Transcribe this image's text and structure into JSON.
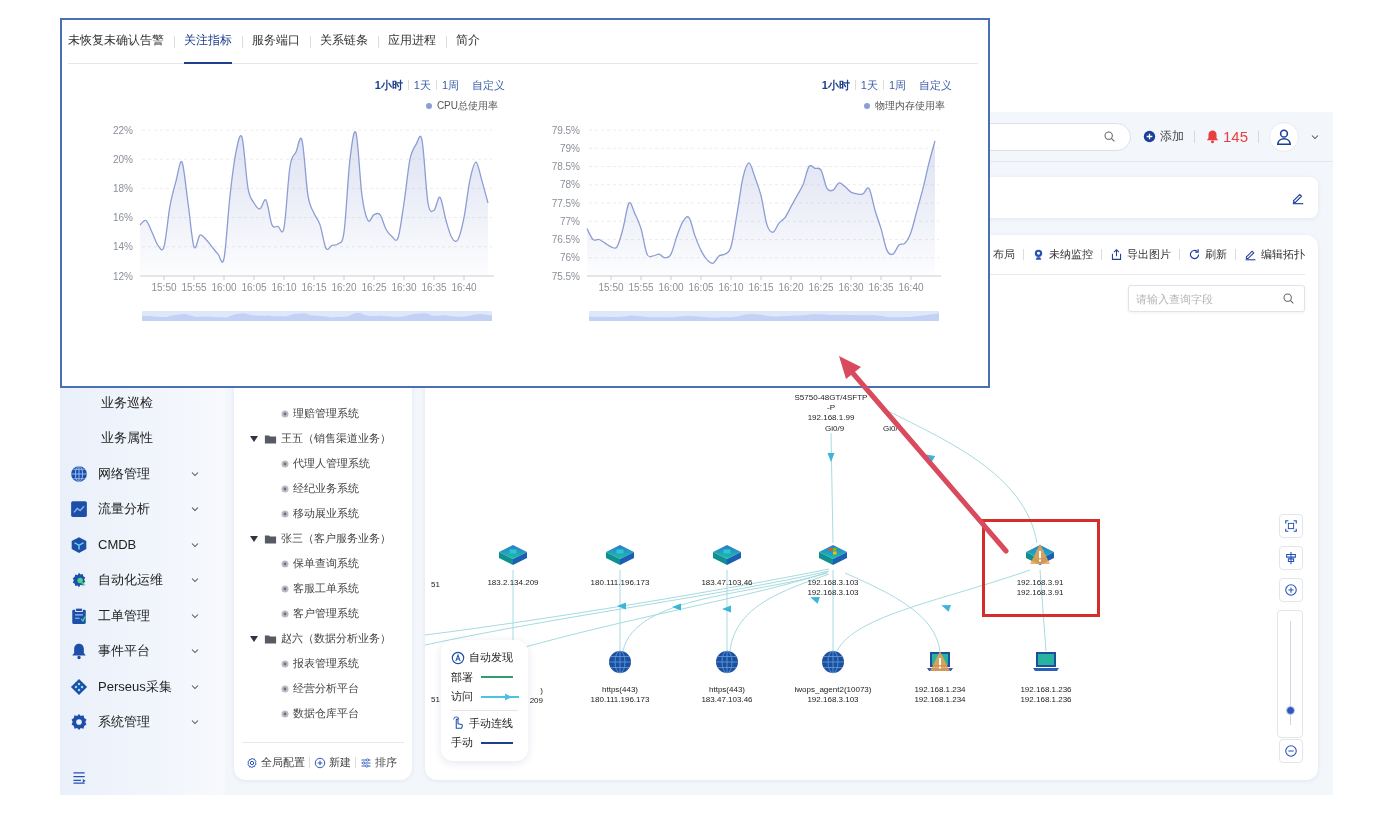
{
  "popup": {
    "tabs": [
      {
        "label": "未恢复未确认告警",
        "selected": false
      },
      {
        "label": "关注指标",
        "selected": true
      },
      {
        "label": "服务端口",
        "selected": false
      },
      {
        "label": "关系链条",
        "selected": false
      },
      {
        "label": "应用进程",
        "selected": false
      },
      {
        "label": "简介",
        "selected": false
      }
    ],
    "panels": [
      {
        "ranges": [
          {
            "label": "1小时",
            "selected": true
          },
          {
            "label": "1天",
            "selected": false
          },
          {
            "label": "1周",
            "selected": false
          }
        ],
        "custom": "自定义",
        "chart_data": {
          "type": "area",
          "grid": true,
          "categories": [
            null,
            null,
            null,
            null,
            "15:50",
            null,
            null,
            null,
            null,
            "15:55",
            null,
            null,
            null,
            null,
            "16:00",
            null,
            null,
            null,
            null,
            "16:05",
            null,
            null,
            null,
            null,
            "16:10",
            null,
            null,
            null,
            null,
            "16:15",
            null,
            null,
            null,
            null,
            "16:20",
            null,
            null,
            null,
            null,
            "16:25",
            null,
            null,
            null,
            null,
            "16:30",
            null,
            null,
            null,
            null,
            "16:35",
            null,
            null,
            null,
            null,
            "16:40",
            null,
            null,
            null,
            null
          ],
          "series": [
            {
              "name": "CPU总使用率",
              "color": "#8d9dd4",
              "values": [
                15.5,
                15.8,
                15.0,
                14.1,
                14.0,
                16.8,
                18.5,
                19.8,
                17.0,
                14.0,
                14.8,
                14.5,
                14.0,
                13.5,
                13.2,
                17.5,
                20.5,
                21.5,
                18.0,
                17.0,
                16.6,
                17.2,
                15.5,
                15.4,
                15.3,
                19.5,
                20.5,
                21.3,
                17.5,
                16.3,
                15.5,
                13.9,
                14.1,
                14.2,
                15.0,
                20.0,
                21.8,
                17.5,
                15.8,
                16.2,
                16.2,
                15.2,
                14.7,
                14.6,
                17.0,
                20.0,
                21.0,
                21.3,
                17.0,
                16.5,
                17.4,
                15.8,
                14.6,
                14.5,
                16.0,
                18.6,
                19.8,
                18.5,
                17.0
              ]
            }
          ],
          "ylim": [
            12,
            22
          ],
          "yticks": [
            {
              "value": 12,
              "label": "12%"
            },
            {
              "value": 14,
              "label": "14%"
            },
            {
              "value": 16,
              "label": "16%"
            },
            {
              "value": 18,
              "label": "18%"
            },
            {
              "value": 20,
              "label": "20%"
            },
            {
              "value": 22,
              "label": "22%"
            }
          ]
        }
      },
      {
        "ranges": [
          {
            "label": "1小时",
            "selected": true
          },
          {
            "label": "1天",
            "selected": false
          },
          {
            "label": "1周",
            "selected": false
          }
        ],
        "custom": "自定义",
        "chart_data": {
          "type": "area",
          "grid": true,
          "categories": [
            null,
            null,
            null,
            null,
            "15:50",
            null,
            null,
            null,
            null,
            "15:55",
            null,
            null,
            null,
            null,
            "16:00",
            null,
            null,
            null,
            null,
            "16:05",
            null,
            null,
            null,
            null,
            "16:10",
            null,
            null,
            null,
            null,
            "16:15",
            null,
            null,
            null,
            null,
            "16:20",
            null,
            null,
            null,
            null,
            "16:25",
            null,
            null,
            null,
            null,
            "16:30",
            null,
            null,
            null,
            null,
            "16:35",
            null,
            null,
            null,
            null,
            "16:40",
            null,
            null,
            null,
            null
          ],
          "series": [
            {
              "name": "物理内存使用率",
              "color": "#8d9dd4",
              "values": [
                76.8,
                76.5,
                76.5,
                76.4,
                76.3,
                76.3,
                76.8,
                77.5,
                77.2,
                76.8,
                76.1,
                76.05,
                76.1,
                76.0,
                76.1,
                76.6,
                77.0,
                77.1,
                76.6,
                76.2,
                75.95,
                75.85,
                76.05,
                76.1,
                76.3,
                77.2,
                78.2,
                78.6,
                78.2,
                77.7,
                76.9,
                76.7,
                76.95,
                77.1,
                77.4,
                77.7,
                78.0,
                78.5,
                78.45,
                78.4,
                77.9,
                77.85,
                78.05,
                77.95,
                77.8,
                77.75,
                77.75,
                77.9,
                77.3,
                76.8,
                76.2,
                76.1,
                76.35,
                76.4,
                76.7,
                77.3,
                77.9,
                78.6,
                79.2
              ]
            }
          ],
          "ylim": [
            75.5,
            79.5
          ],
          "yticks": [
            {
              "value": 75.5,
              "label": "75.5%"
            },
            {
              "value": 76,
              "label": "76%"
            },
            {
              "value": 76.5,
              "label": "76.5%"
            },
            {
              "value": 77,
              "label": "77%"
            },
            {
              "value": 77.5,
              "label": "77.5%"
            },
            {
              "value": 78,
              "label": "78%"
            },
            {
              "value": 78.5,
              "label": "78.5%"
            },
            {
              "value": 79,
              "label": "79%"
            },
            {
              "value": 79.5,
              "label": "79.5%"
            }
          ]
        }
      }
    ]
  },
  "header": {
    "add_label": "添加",
    "alert_count": "145"
  },
  "sidebar": {
    "items": [
      {
        "label": "业务巡检",
        "kind": "sub"
      },
      {
        "label": "业务属性",
        "kind": "sub"
      },
      {
        "label": "网络管理",
        "kind": "menu",
        "expanded": false
      },
      {
        "label": "流量分析",
        "kind": "menu",
        "expanded": false
      },
      {
        "label": "CMDB",
        "kind": "menu",
        "expanded": false
      },
      {
        "label": "自动化运维",
        "kind": "menu",
        "expanded": false
      },
      {
        "label": "工单管理",
        "kind": "menu",
        "expanded": false
      },
      {
        "label": "事件平台",
        "kind": "menu",
        "expanded": false
      },
      {
        "label": "Perseus采集",
        "kind": "menu",
        "expanded": false
      },
      {
        "label": "系统管理",
        "kind": "menu",
        "expanded": false
      }
    ]
  },
  "tree": {
    "nodes": [
      {
        "label": "理赔管理系统"
      },
      {
        "label": "王五（销售渠道业务）",
        "expanded": true,
        "children": [
          {
            "label": "代理人管理系统"
          },
          {
            "label": "经纪业务系统"
          },
          {
            "label": "移动展业系统"
          }
        ]
      },
      {
        "label": "张三（客户服务业务）",
        "expanded": true,
        "children": [
          {
            "label": "保单查询系统"
          },
          {
            "label": "客服工单系统"
          },
          {
            "label": "客户管理系统"
          }
        ]
      },
      {
        "label": "赵六（数据分析业务）",
        "expanded": true,
        "children": [
          {
            "label": "报表管理系统"
          },
          {
            "label": "经营分析平台"
          },
          {
            "label": "数据仓库平台"
          }
        ]
      }
    ],
    "footer": [
      "全局配置",
      "新建",
      "排序"
    ]
  },
  "toolbar": {
    "actions": [
      "布局",
      "未纳监控",
      "导出图片",
      "刷新",
      "编辑拓扑"
    ]
  },
  "search": {
    "placeholder": "请输入查询字段"
  },
  "topology": {
    "nodes": [
      {
        "kind": "label",
        "lines": [
          "S5750-48GT/4SFTP",
          "-P",
          "192.168.1.99"
        ]
      },
      {
        "kind": "server",
        "alert": false,
        "lines": [
          "183.2.134.209"
        ]
      },
      {
        "kind": "server",
        "alert": false,
        "lines": [
          "180.111.196.173"
        ]
      },
      {
        "kind": "server",
        "alert": false,
        "lines": [
          "183.47.103.46"
        ]
      },
      {
        "kind": "windows-server",
        "alert": false,
        "lines": [
          "192.168.3.103",
          "192.168.3.103"
        ]
      },
      {
        "kind": "server",
        "alert": true,
        "lines": [
          "192.168.3.91",
          "192.168.3.91"
        ]
      },
      {
        "kind": "globe",
        "alert": false,
        "lines": [
          "https(443)",
          "180.111.196.173"
        ]
      },
      {
        "kind": "globe",
        "alert": false,
        "lines": [
          "https(443)",
          "183.47.103.46"
        ]
      },
      {
        "kind": "globe",
        "alert": false,
        "lines": [
          "lwops_agent2(10073)",
          "192.168.3.103"
        ]
      },
      {
        "kind": "laptop",
        "alert": true,
        "lines": [
          "192.168.1.234",
          "192.168.1.234"
        ]
      },
      {
        "kind": "laptop",
        "alert": false,
        "lines": [
          "192.168.1.236",
          "192.168.1.236"
        ]
      },
      {
        "kind": "label",
        "lines": [
          "51"
        ]
      },
      {
        "kind": "label",
        "lines": [
          "51"
        ]
      },
      {
        "kind": "label",
        "lines": [
          ")",
          "209"
        ]
      }
    ],
    "ports": [
      "Gi0/9",
      "Gi0/"
    ]
  },
  "legend": {
    "items": [
      {
        "kind": "section",
        "label": "自动发现"
      },
      {
        "kind": "line",
        "label": "部署",
        "color": "#2f9e6e"
      },
      {
        "kind": "arrow",
        "label": "访问",
        "color": "#4cc2e0"
      },
      {
        "kind": "section",
        "label": "手动连线"
      },
      {
        "kind": "line",
        "label": "手动",
        "color": "#1f3d8f"
      }
    ]
  },
  "zoom": {
    "level": 0.14
  }
}
